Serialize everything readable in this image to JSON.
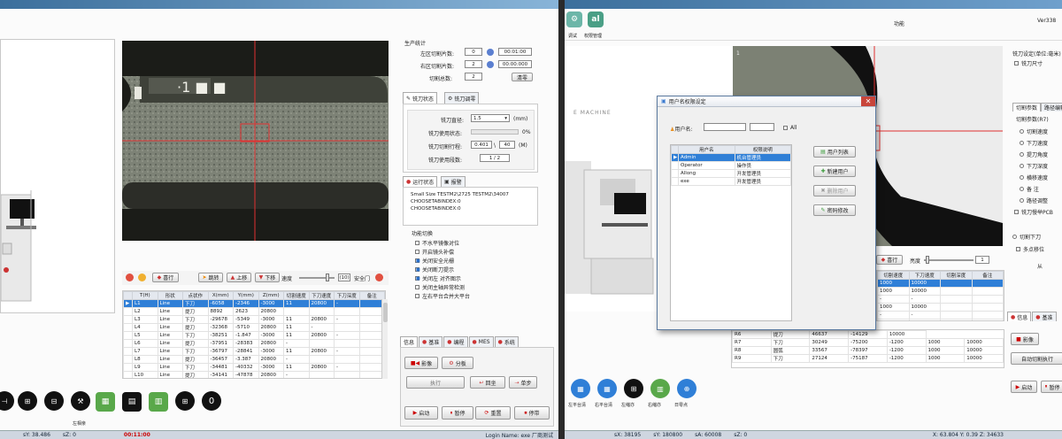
{
  "left": {
    "camera": {
      "marks": "·1 ■ ■"
    },
    "production": {
      "group_title": "生产统计",
      "left_count_label": "左区切割片数:",
      "left_count": "0",
      "left_time": "00:01:00",
      "right_count_label": "右区切割片数:",
      "right_count": "2",
      "right_time": "00:00:000",
      "cut_count_label": "切割总数:",
      "cut_count": "2",
      "clear_label": "清零"
    },
    "tool_tabs": {
      "tab1": "铣刀状态",
      "tab2": "铣刀调零"
    },
    "tool": {
      "diameter_label": "铣刀直径:",
      "diameter": "1.5",
      "diameter_unit": "(mm)",
      "usage_label": "铣刀使用状态:",
      "usage_pct": "0%",
      "usage_fraction": 0,
      "life_label": "铣刀切割行程:",
      "life_a": "0.401",
      "life_b": "40",
      "life_unit": "(M)",
      "cnt_label": "铣刀使用段数:",
      "cnt": "1 / 2"
    },
    "log_tabs": {
      "tab1": "运行状态",
      "tab2": "报警"
    },
    "log_lines": [
      "Small Size TESTM2\\2725 TESTM2\\34007",
      "CHOOSETABINDEX:0",
      "CHOOSETABINDEX:0"
    ],
    "functions": {
      "title": "功能切换",
      "items": [
        {
          "label": "不水平镜像对位",
          "checked": false
        },
        {
          "label": "开启镜头补偿",
          "checked": false
        },
        {
          "label": "关闭安全光栅",
          "checked": true
        },
        {
          "label": "关闭断刀提示",
          "checked": true
        },
        {
          "label": "关闭左 对齐图示",
          "checked": true
        },
        {
          "label": "关闭主轴异常检测",
          "checked": false
        },
        {
          "label": "左右平台合并大平台",
          "checked": false
        }
      ]
    },
    "toolbar": {
      "row_label": "喜行",
      "jump": "跳转",
      "up": "上移",
      "down": "下移",
      "speed_label": "速度",
      "speed_value": "(10)",
      "safe_label": "安全门"
    },
    "table": {
      "headers": [
        "T(H)",
        "形状",
        "点状作",
        "X(mm)",
        "Y(mm)",
        "Z(mm)",
        "切割速度",
        "下刀速度",
        "下刀深度",
        "备注"
      ],
      "rows": [
        [
          "L1",
          "Line",
          "下刀",
          "-6058",
          "-2346",
          "-3000",
          "11",
          "20800",
          "-",
          ""
        ],
        [
          "L2",
          "Line",
          "提刀",
          "8892",
          "2623",
          "20800",
          "",
          "",
          "",
          ""
        ],
        [
          "L3",
          "Line",
          "下刀",
          "-29678",
          "-5349",
          "-3000",
          "11",
          "20800",
          "-",
          ""
        ],
        [
          "L4",
          "Line",
          "提刀",
          "-32368",
          "-5710",
          "20800",
          "11",
          "-",
          "",
          ""
        ],
        [
          "L5",
          "Line",
          "下刀",
          "-38251",
          "-1.847",
          "-3000",
          "11",
          "20800",
          "-",
          ""
        ],
        [
          "L6",
          "Line",
          "提刀",
          "-37951",
          "-28383",
          "20800",
          "-",
          "",
          "",
          ""
        ],
        [
          "L7",
          "Line",
          "下刀",
          "-36797",
          "-28841",
          "-3000",
          "11",
          "20800",
          "-",
          ""
        ],
        [
          "L8",
          "Line",
          "提刀",
          "-36457",
          "-3.387",
          "20800",
          "-",
          "",
          "",
          ""
        ],
        [
          "L9",
          "Line",
          "下刀",
          "-34481",
          "-40332",
          "-3000",
          "11",
          "20800",
          "-",
          ""
        ],
        [
          "L10",
          "Line",
          "提刀",
          "-34141",
          "-47878",
          "20800",
          "-",
          "",
          "",
          ""
        ],
        [
          "L11",
          "Line",
          "下刀",
          "-33461",
          "-52608",
          "-3000",
          "11",
          "20800",
          "-",
          ""
        ]
      ]
    },
    "bottom_tabs": [
      "信息",
      "基准",
      "编程",
      "MES",
      "系统"
    ],
    "actions": {
      "image": "影像",
      "analysis": "分板",
      "exec": "执行",
      "restore": "回坐",
      "single": "单步",
      "start": "启动",
      "pause": "暂停",
      "reset": "重置",
      "stop": "停带"
    },
    "icon_bar": {
      "caption": "左相亲"
    },
    "status": {
      "x": "sY: 38.486",
      "z": "sZ: 0",
      "time": "00:11:00",
      "login": "Login Name: exe  厂商测试"
    }
  },
  "right": {
    "top": {
      "icon1_label": "调试",
      "icon2_label": "权限管理",
      "title": "功能",
      "version": "Ver338"
    },
    "machine_text": "E MACHINE",
    "side": {
      "title": "铣刀设定(单位:毫米)",
      "size_label": "铣刀尺寸",
      "tab1": "切割参数",
      "tab2": "路径编辑",
      "param_title": "切割参数(R7)",
      "radios": [
        "切割速度",
        "下刀速度",
        "提刀角度",
        "下刀深度",
        "横移速度",
        "备   注",
        "路径调整"
      ],
      "pcb_label": "铣刀慢举PCB",
      "cut_label": "切割下刀",
      "multi_label": "多点移位",
      "from_label": "从"
    },
    "dialog": {
      "title": "用户名权限设定",
      "user_label": "用户名:",
      "all_label": "All",
      "headers": [
        "用户名",
        "权限说明"
      ],
      "rows": [
        [
          "Admin",
          "机台管理员"
        ],
        [
          "Operator",
          "操作员"
        ],
        [
          "Allong",
          "开发管理员"
        ],
        [
          "exe",
          "开发管理员"
        ]
      ],
      "btn_list": "用户列表",
      "btn_new": "新建用户",
      "btn_del": "删除用户",
      "btn_pwd": "密码修改"
    },
    "toolbar": {
      "row_label": "喜行",
      "speed_label": "亮度",
      "speed_value": "1"
    },
    "table": {
      "headers": [
        "切割速度",
        "下刀速度",
        "切割深度",
        "备注"
      ],
      "rows": [
        [
          "1000",
          "10000",
          "",
          ""
        ],
        [
          "1000",
          "10000",
          "",
          ""
        ],
        [
          "-",
          "-",
          "",
          ""
        ],
        [
          "1000",
          "10000",
          "",
          ""
        ],
        [
          "-",
          "-",
          "",
          ""
        ],
        [
          "1000",
          "10000",
          "",
          ""
        ]
      ]
    },
    "lower_rows": [
      [
        "R6",
        "提刀",
        "46637",
        "-14129",
        "10000"
      ],
      [
        "R7",
        "下刀",
        "30249",
        "-75200",
        "-1200",
        "1000",
        "10000"
      ],
      [
        "R8",
        "圆弧",
        "33567",
        "-78397",
        "-1200",
        "1000",
        "10000"
      ],
      [
        "R9",
        "下刀",
        "27124",
        "-75187",
        "-1200",
        "1000",
        "10000"
      ]
    ],
    "right_tabs": [
      "信息",
      "基准"
    ],
    "right_btns": {
      "image": "影像",
      "auto": "自动切割执行",
      "start": "启动",
      "stop": "暂停"
    },
    "icons": [
      "左平台清",
      "右平台清",
      "左缩亦",
      "右缩亦",
      "日零点"
    ],
    "status": {
      "sx": "sX: 38195",
      "sy": "sY: 180800",
      "sa": "sA: 60008",
      "sz": "sZ: 0",
      "xyz": "X: 63.804  Y: 0.39  Z: 34633"
    }
  }
}
